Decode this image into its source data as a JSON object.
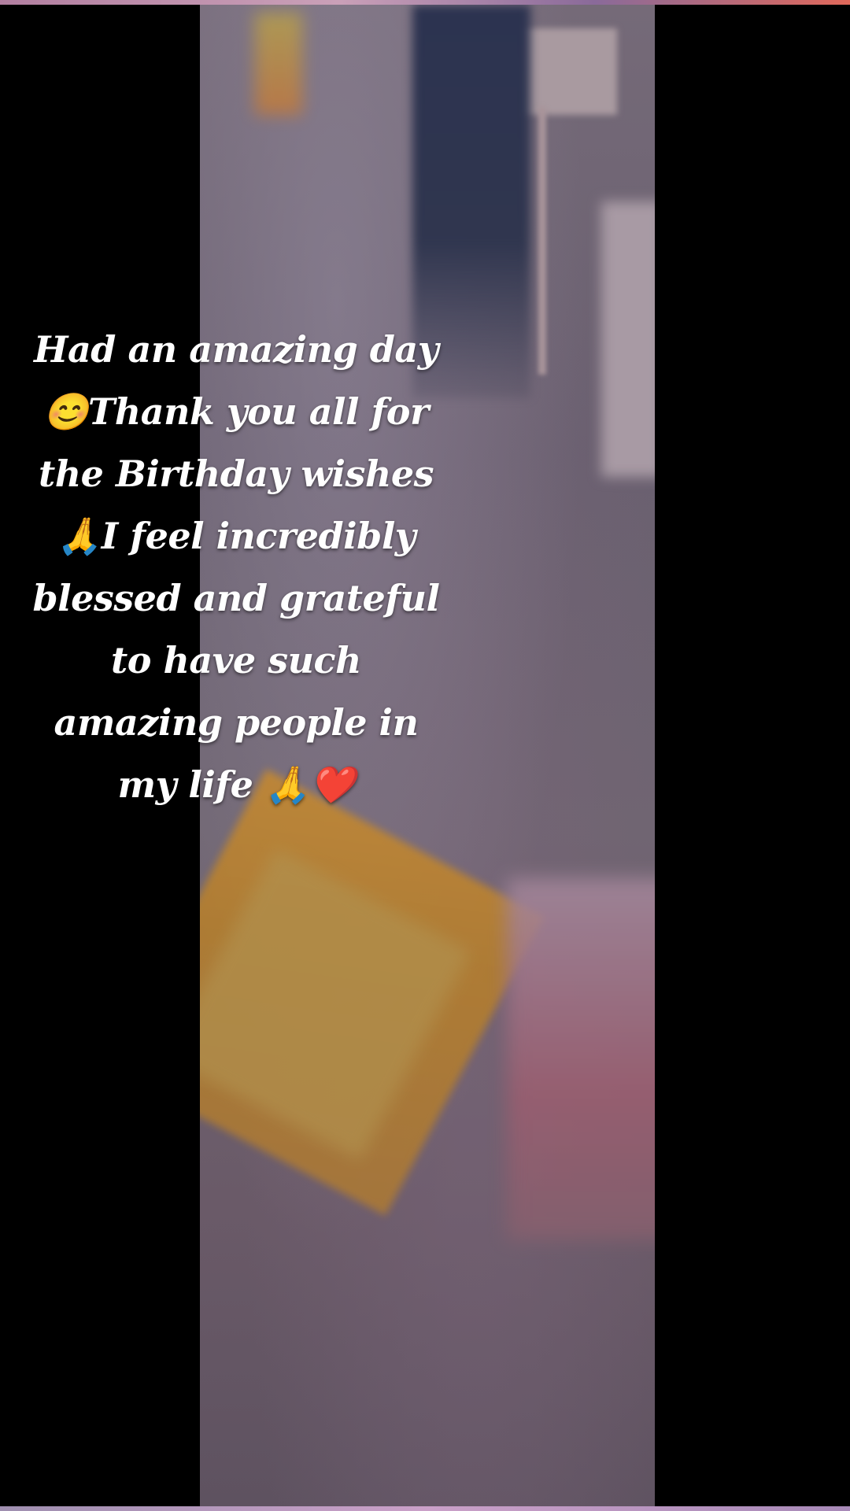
{
  "story": {
    "caption": "Had an amazing day\n😊Thank you all for\nthe Birthday wishes\n🙏I feel incredibly\nblessed and grateful\nto have such\namazing people in\nmy life 🙏❤️"
  },
  "colors": {
    "background": "#000000",
    "caption_text": "#ffffff",
    "top_bar_accent": "#e0685a"
  }
}
